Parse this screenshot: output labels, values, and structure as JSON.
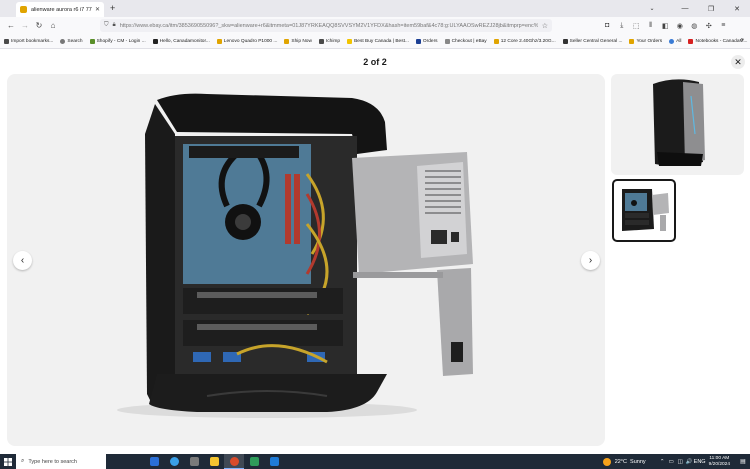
{
  "browser": {
    "tab": {
      "title": "alienware aurora r6 i7 7700k 16GB RAM",
      "close": "✕"
    },
    "new_tab": "+",
    "tab_list": "⌄",
    "window_controls": {
      "minimize": "—",
      "maximize": "❐",
      "close": "✕"
    },
    "nav": {
      "back": "←",
      "forward": "→",
      "reload": "↻",
      "home": "⌂",
      "url": "https://www.ebay.ca/itm/385369055096?_skw=alienware+r6&itmmeta=01J87YRKEAQQ8SVVSYM2V1YFDX&hash=item59baf&4c78:g:ULYAAOSwREZJ28jb&itmprp=enc%3AAQA..."
    },
    "bookmarks": [
      {
        "label": "Import bookmarks...",
        "color": "#4a4a4a"
      },
      {
        "label": "Search",
        "color": "#777777"
      },
      {
        "label": "Shopify - CM - Login ...",
        "color": "#5a8f29"
      },
      {
        "label": "Hello, Canadamonitor...",
        "color": "#222222"
      },
      {
        "label": "Lenovo Quadro P1000 ...",
        "color": "#e0a400"
      },
      {
        "label": "Ship Now",
        "color": "#e0a400"
      },
      {
        "label": "Ichimp",
        "color": "#4a4a4a"
      },
      {
        "label": "Best Buy Canada | Best...",
        "color": "#f2c400"
      },
      {
        "label": "Orders",
        "color": "#1c3f94"
      },
      {
        "label": "Checkout | eBay",
        "color": "#888888"
      },
      {
        "label": "12 Core 2.40Ghz/3.20G...",
        "color": "#e0a400"
      },
      {
        "label": "Seller Central General ...",
        "color": "#333333"
      },
      {
        "label": "Your Orders",
        "color": "#e0a400"
      },
      {
        "label": "All",
        "color": "#3a7bd5"
      },
      {
        "label": "Notebooks - CanadaM...",
        "color": "#d62020"
      }
    ],
    "bookmarks_more": "»"
  },
  "viewer": {
    "counter": "2 of 2",
    "close": "✕",
    "prev": "‹",
    "next": "›",
    "images": [
      {
        "alt": "Alienware Aurora R6 tower front"
      },
      {
        "alt": "Alienware Aurora R6 open chassis interior"
      }
    ]
  },
  "taskbar": {
    "search_placeholder": "Type here to search",
    "app_colors": [
      "#2b6fd6",
      "#3aa0e8",
      "#7a7a7a",
      "#f4c430",
      "#d94b2b",
      "#2e9c5a",
      "#1f7bd6"
    ],
    "weather": {
      "temp": "22°C",
      "condition": "Sunny"
    },
    "tray": [
      "⌃",
      "▭",
      "◫",
      "🔊",
      "ENG"
    ],
    "clock": {
      "time": "11:00 AM",
      "date": "9/20/2024"
    }
  },
  "colors": {
    "tab_strip": "#e8e8ed",
    "taskbar": "#1f2a38",
    "stage": "#f1f1f1",
    "thumb_selected_border": "#191919"
  }
}
